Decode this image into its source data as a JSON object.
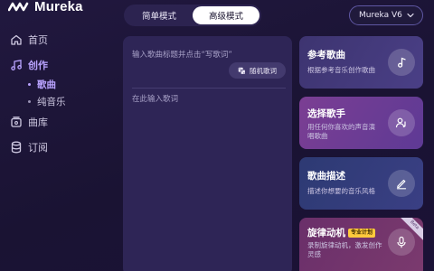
{
  "app": {
    "name": "Mureka"
  },
  "sidebar": {
    "items": [
      {
        "label": "首页",
        "icon": "home-icon"
      },
      {
        "label": "创作",
        "icon": "music-note-icon",
        "active": true
      },
      {
        "label": "曲库",
        "icon": "library-icon"
      },
      {
        "label": "订阅",
        "icon": "database-icon"
      }
    ],
    "sub_items": [
      {
        "label": "歌曲",
        "active": true
      },
      {
        "label": "纯音乐"
      }
    ]
  },
  "mode_toggle": {
    "simple_label": "简单模式",
    "advanced_label": "高级模式",
    "selected": "高级模式"
  },
  "version_select": {
    "value": "Mureka V6"
  },
  "editor": {
    "title_placeholder": "输入歌曲标题并点击“写歌词”",
    "random_lyrics_label": "随机歌词",
    "lyrics_placeholder": "在此输入歌词"
  },
  "cards": {
    "reference": {
      "title": "参考歌曲",
      "desc": "根据参考音乐创作歌曲"
    },
    "singer": {
      "title": "选择歌手",
      "desc": "用任何你喜欢的声音演唱歌曲"
    },
    "description": {
      "title": "歌曲描述",
      "desc": "描述你想要的音乐风格"
    },
    "motif": {
      "title": "旋律动机",
      "badge": "专业计划",
      "desc": "录制旋律动机，激发创作灵感",
      "ribbon": "Beta"
    }
  },
  "colors": {
    "accent": "#b9a3ff",
    "background": "#1a1235",
    "badge": "#ffc93c"
  }
}
